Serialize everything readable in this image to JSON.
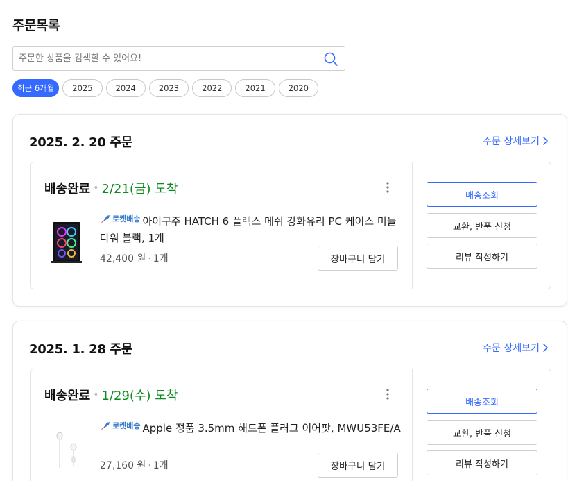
{
  "page": {
    "title": "주문목록"
  },
  "search": {
    "placeholder": "주문한 상품을 검색할 수 있어요!",
    "value": ""
  },
  "tabs": [
    {
      "label": "최근 6개월",
      "active": true
    },
    {
      "label": "2025",
      "active": false
    },
    {
      "label": "2024",
      "active": false
    },
    {
      "label": "2023",
      "active": false
    },
    {
      "label": "2022",
      "active": false
    },
    {
      "label": "2021",
      "active": false
    },
    {
      "label": "2020",
      "active": false
    }
  ],
  "colors": {
    "accent": "#346aff",
    "delivered_green": "#0a8a1f",
    "rocket_blue": "#3a7ccf"
  },
  "orders": [
    {
      "date": "2025. 2. 20 주문",
      "detail_link": "주문 상세보기",
      "status": "배송완료",
      "arrival": "2/21(금) 도착",
      "badge": "로켓배송",
      "product_name": "아이구주 HATCH 6 플렉스 메쉬 강화유리 PC 케이스 미들타워 블랙, 1개",
      "price": "42,400 원",
      "quantity": "1개",
      "cart_button": "장바구니 담기",
      "thumbnail_icon": "pc-case-icon",
      "actions": [
        "배송조회",
        "교환, 반품 신청",
        "리뷰 작성하기"
      ]
    },
    {
      "date": "2025. 1. 28 주문",
      "detail_link": "주문 상세보기",
      "status": "배송완료",
      "arrival": "1/29(수) 도착",
      "badge": "로켓배송",
      "product_name": "Apple 정품 3.5mm 해드폰 플러그 이어팟, MWU53FE/A",
      "price": "27,160 원",
      "quantity": "1개",
      "cart_button": "장바구니 담기",
      "thumbnail_icon": "earpods-icon",
      "actions": [
        "배송조회",
        "교환, 반품 신청",
        "리뷰 작성하기"
      ]
    }
  ]
}
